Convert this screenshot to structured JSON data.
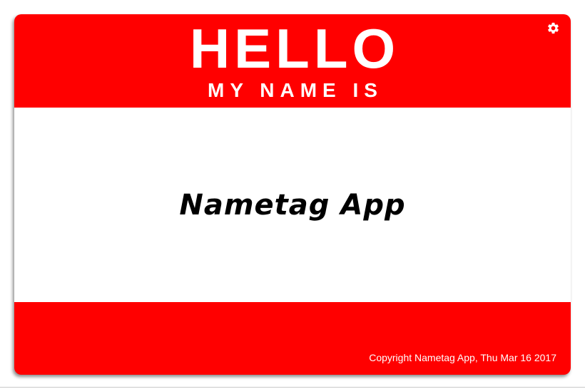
{
  "nametag": {
    "heading": "HELLO",
    "subheading": "MY NAME IS",
    "name": "Nametag App",
    "settings_icon": "gear-icon"
  },
  "footer": {
    "copyright": "Copyright Nametag App, Thu Mar 16 2017"
  },
  "colors": {
    "tag_red": "#ff0000",
    "name_area": "#ffffff",
    "text_light": "#ffffff",
    "text_dark": "#000000"
  }
}
